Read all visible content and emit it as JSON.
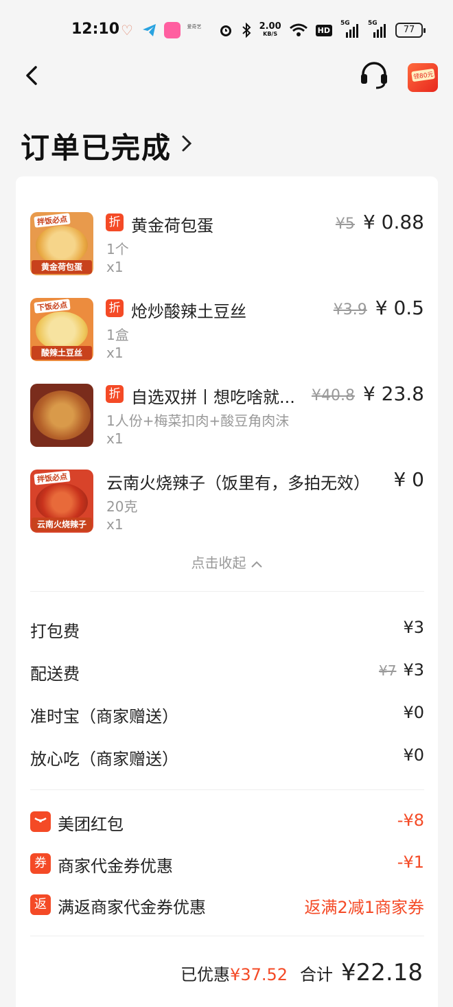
{
  "status_bar": {
    "time": "12:10",
    "net_speed": "2.00",
    "net_unit": "KB/S",
    "hd_label": "HD",
    "sim1_label": "5G",
    "sim2_label": "5G",
    "battery": "77",
    "app4_label": "爱奇艺"
  },
  "nav": {
    "promo_tag": "领80元"
  },
  "order": {
    "title": "订单已完成"
  },
  "items": [
    {
      "name": "黄金荷包蛋",
      "spec": "1个",
      "qty": "x1",
      "orig_price": "¥5",
      "price": "¥ 0.88",
      "discount_badge": "折",
      "thumb_caption": "黄金荷包蛋",
      "thumb_tag": "拌饭必点"
    },
    {
      "name": "炝炒酸辣土豆丝",
      "spec": "1盒",
      "qty": "x1",
      "orig_price": "¥3.9",
      "price": "¥ 0.5",
      "discount_badge": "折",
      "thumb_caption": "酸辣土豆丝",
      "thumb_tag": "下饭必点"
    },
    {
      "name": "自选双拼丨想吃啥就...",
      "spec": "1人份+梅菜扣肉+酸豆角肉沫",
      "qty": "x1",
      "orig_price": "¥40.8",
      "price": "¥ 23.8",
      "discount_badge": "折",
      "thumb_caption": "",
      "thumb_tag": ""
    },
    {
      "name": "云南火烧辣子（饭里有，多拍无效）",
      "spec": "20克",
      "qty": "x1",
      "orig_price": "",
      "price": "¥ 0",
      "discount_badge": "",
      "thumb_caption": "云南火烧辣子",
      "thumb_tag": "拌饭必点"
    }
  ],
  "collapse_label": "点击收起",
  "fees": [
    {
      "label": "打包费",
      "orig": "",
      "value": "¥3"
    },
    {
      "label": "配送费",
      "orig": "¥7",
      "value": "¥3"
    },
    {
      "label": "准时宝（商家赠送）",
      "orig": "",
      "value": "¥0"
    },
    {
      "label": "放心吃（商家赠送）",
      "orig": "",
      "value": "¥0"
    }
  ],
  "discounts": [
    {
      "icon": "red-packet-icon",
      "icon_text": "",
      "label": "美团红包",
      "value": "-¥8"
    },
    {
      "icon": "voucher-icon",
      "icon_text": "券",
      "label": "商家代金券优惠",
      "value": "-¥1"
    },
    {
      "icon": "rebate-icon",
      "icon_text": "返",
      "label": "满返商家代金券优惠",
      "value": "返满2减1商家券"
    }
  ],
  "summary": {
    "saved_label": "已优惠",
    "saved_value": "¥37.52",
    "total_label": "合计",
    "total_value": "¥22.18"
  },
  "colors": {
    "accent": "#f44a26",
    "background": "#f5f5f5",
    "card": "#ffffff"
  }
}
